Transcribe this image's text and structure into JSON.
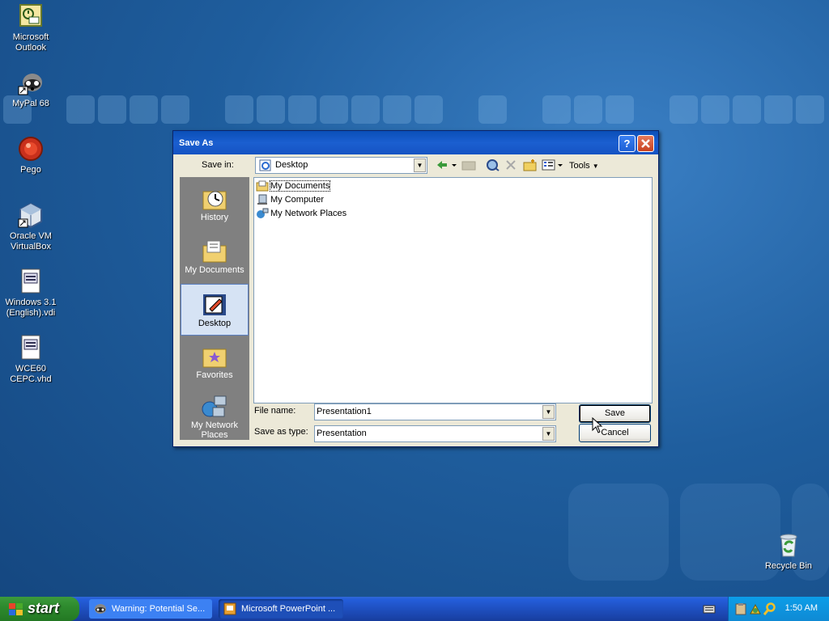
{
  "desktop": {
    "icons": [
      {
        "label": "Microsoft Outlook"
      },
      {
        "label": "MyPal 68"
      },
      {
        "label": "Pego"
      },
      {
        "label": "Oracle VM VirtualBox"
      },
      {
        "label": "Windows 3.1 (English).vdi"
      },
      {
        "label": "WCE60 CEPC.vhd"
      },
      {
        "label": "Recycle Bin"
      }
    ]
  },
  "dialog": {
    "title": "Save As",
    "save_in_label": "Save in:",
    "save_in_value": "Desktop",
    "tools_label": "Tools",
    "places": [
      "History",
      "My Documents",
      "Desktop",
      "Favorites",
      "My Network Places"
    ],
    "active_place": "Desktop",
    "files": [
      "My Documents",
      "My Computer",
      "My Network Places"
    ],
    "file_name_label": "File name:",
    "file_name_value": "Presentation1",
    "save_as_type_label": "Save as type:",
    "save_as_type_value": "Presentation",
    "save_button": "Save",
    "cancel_button": "Cancel"
  },
  "taskbar": {
    "start_label": "start",
    "tasks": [
      "Warning: Potential Se...",
      "Microsoft PowerPoint ..."
    ],
    "clock": "1:50 AM"
  },
  "colors": {
    "desktop_blue": "#1f5e9e",
    "titlebar_blue": "#0a4fb8",
    "start_green": "#2e8b2e",
    "tray_blue": "#0f8ad4"
  }
}
